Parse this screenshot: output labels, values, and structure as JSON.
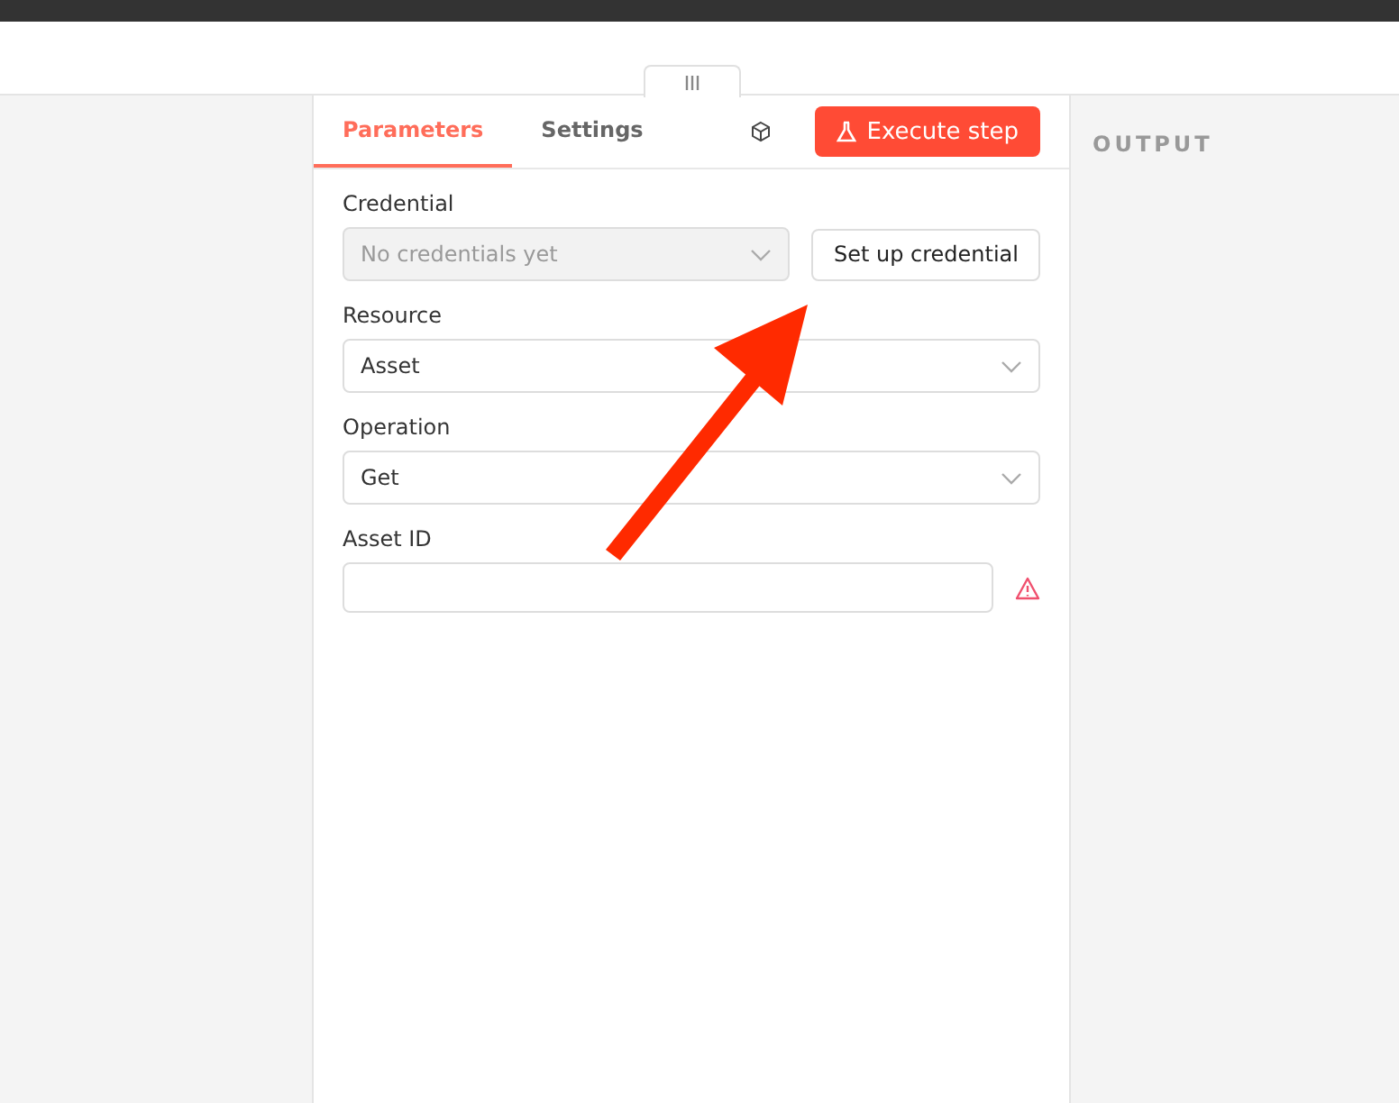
{
  "tabs": [
    {
      "label": "Parameters",
      "selected": true
    },
    {
      "label": "Settings",
      "selected": false
    }
  ],
  "execute_button": "Execute step",
  "output_heading": "OUTPUT",
  "fields": [
    {
      "kind": "select",
      "label": "Credential",
      "placeholder": "No credentials yet",
      "disabled": true,
      "button": "Set up credential"
    },
    {
      "kind": "select",
      "label": "Resource",
      "value": "Asset",
      "disabled": false
    },
    {
      "kind": "select",
      "label": "Operation",
      "value": "Get",
      "disabled": false
    },
    {
      "kind": "input",
      "label": "Asset ID",
      "warning": true
    }
  ]
}
